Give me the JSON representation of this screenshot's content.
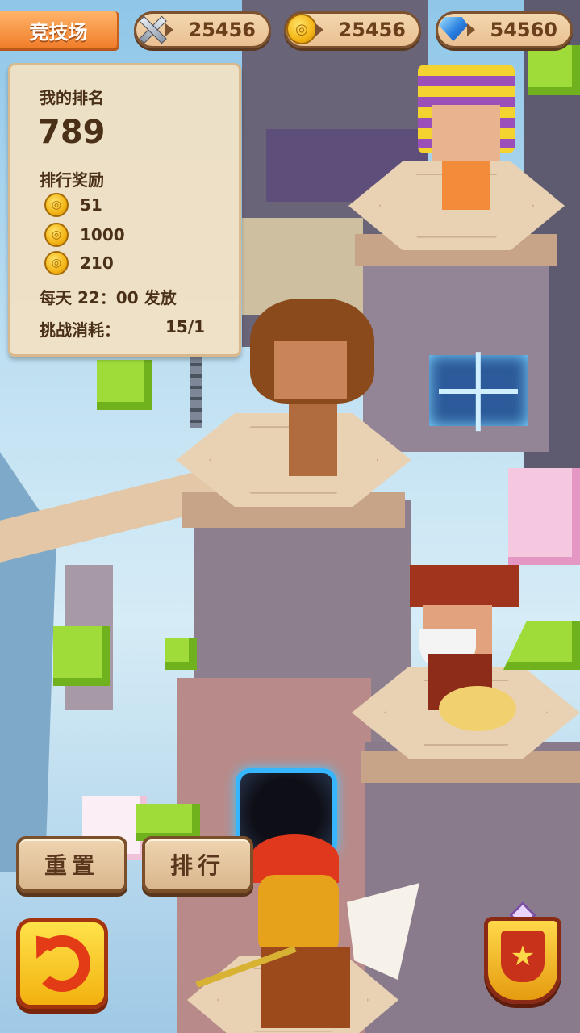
{
  "header": {
    "arena_label": "竞技场",
    "resources": [
      {
        "icon": "crossed-swords-icon",
        "value": "25456"
      },
      {
        "icon": "gold-coin-icon",
        "value": "25456"
      },
      {
        "icon": "blue-gem-icon",
        "value": "54560"
      }
    ]
  },
  "panel": {
    "my_rank_label": "我的排名",
    "my_rank_value": "789",
    "rewards_label": "排行奖励",
    "rewards": [
      {
        "icon": "gold-coin-icon",
        "value": "51"
      },
      {
        "icon": "gold-coin-icon",
        "value": "1000"
      },
      {
        "icon": "gold-coin-icon",
        "value": "210"
      }
    ],
    "daily_release": "每天 22：00 发放",
    "challenge_cost_label": "挑战消耗：",
    "challenge_cost_value": "15/1"
  },
  "buttons": {
    "reset_label": "重置",
    "ranking_label": "排行"
  },
  "colors": {
    "accent_orange": "#f07d2a",
    "panel_bg": "#f0e0c4",
    "text_brown": "#4b3018",
    "gem_blue": "#2a7fe0",
    "coin_gold": "#f4b516"
  }
}
